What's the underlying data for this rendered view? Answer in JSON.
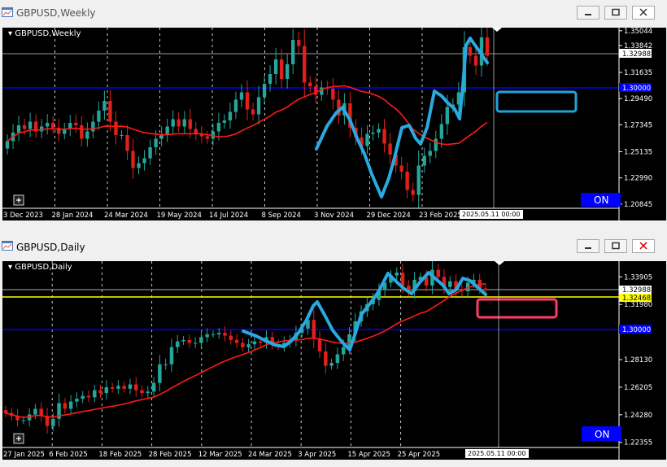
{
  "weekly": {
    "window_title": "GBPUSD,Weekly",
    "chart_label": "GBPUSD,Weekly",
    "on_label": "ON",
    "x_labels": [
      "3 Dec 2023",
      "28 Jan 2024",
      "24 Mar 2024",
      "19 May 2024",
      "14 Jul 2024",
      "8 Sep 2024",
      "3 Nov 2024",
      "29 Dec 2024",
      "23 Feb 2025"
    ],
    "date_box": "2025.05.11 00:00",
    "price_labels": [
      "1.35044",
      "1.33842",
      "1.31635",
      "1.29490",
      "1.27345",
      "1.25135",
      "1.22990",
      "1.20845"
    ],
    "current_price": "1.32988",
    "blue_line_price": "1.30000"
  },
  "daily": {
    "window_title": "GBPUSD,Daily",
    "chart_label": "GBPUSD,Daily",
    "on_label": "ON",
    "x_labels": [
      "27 Jan 2025",
      "6 Feb 2025",
      "18 Feb 2025",
      "28 Feb 2025",
      "12 Mar 2025",
      "24 Mar 2025",
      "3 Apr 2025",
      "15 Apr 2025",
      "25 Apr 2025"
    ],
    "date_box": "2025.05.11 00:00",
    "price_labels": [
      "1.33905",
      "1.31980",
      "1.28130",
      "1.26205",
      "1.24280",
      "1.22355"
    ],
    "current_price": "1.32988",
    "yellow_price": "1.32468",
    "blue_line_price": "1.30000"
  },
  "colors": {
    "bull": "#26a69a",
    "bear": "#e0201b",
    "ma": "#ff1a1a",
    "drawing": "#2aa9e0",
    "weekly_box": "#1fa5dd",
    "daily_box": "#ff3b6b",
    "level_blue": "#0000ff",
    "level_yellow": "#ffff00"
  },
  "chart_data": [
    {
      "type": "candlestick",
      "title": "GBPUSD,Weekly",
      "xlabels": [
        "3 Dec 2023",
        "28 Jan 2024",
        "24 Mar 2024",
        "19 May 2024",
        "14 Jul 2024",
        "8 Sep 2024",
        "3 Nov 2024",
        "29 Dec 2024",
        "23 Feb 2025"
      ],
      "ylim": [
        1.205,
        1.353
      ],
      "ma_period": 20,
      "close": [
        1.26,
        1.267,
        1.273,
        1.27,
        1.276,
        1.268,
        1.272,
        1.275,
        1.271,
        1.266,
        1.27,
        1.275,
        1.273,
        1.262,
        1.268,
        1.276,
        1.285,
        1.293,
        1.276,
        1.265,
        1.265,
        1.252,
        1.238,
        1.242,
        1.246,
        1.255,
        1.262,
        1.265,
        1.272,
        1.278,
        1.272,
        1.278,
        1.27,
        1.266,
        1.264,
        1.262,
        1.268,
        1.275,
        1.277,
        1.284,
        1.294,
        1.3,
        1.286,
        1.282,
        1.296,
        1.307,
        1.315,
        1.327,
        1.311,
        1.323,
        1.343,
        1.338,
        1.308,
        1.305,
        1.298,
        1.304,
        1.303,
        1.294,
        1.281,
        1.291,
        1.271,
        1.263,
        1.256,
        1.266,
        1.267,
        1.27,
        1.258,
        1.249,
        1.24,
        1.235,
        1.22,
        1.216,
        1.24,
        1.248,
        1.252,
        1.262,
        1.274,
        1.288,
        1.29,
        1.3,
        1.337,
        1.33,
        1.322,
        1.345,
        1.33
      ],
      "note": "Daily horizontal levels 1.30000, current 1.32988"
    },
    {
      "type": "candlestick",
      "title": "GBPUSD,Daily",
      "xlabels": [
        "27 Jan 2025",
        "6 Feb 2025",
        "18 Feb 2025",
        "28 Feb 2025",
        "12 Mar 2025",
        "24 Mar 2025",
        "3 Apr 2025",
        "15 Apr 2025",
        "25 Apr 2025"
      ],
      "ylim": [
        1.22,
        1.35
      ],
      "ma_period": 20,
      "close": [
        1.244,
        1.242,
        1.239,
        1.239,
        1.243,
        1.247,
        1.242,
        1.235,
        1.24,
        1.251,
        1.247,
        1.252,
        1.254,
        1.256,
        1.255,
        1.26,
        1.258,
        1.262,
        1.261,
        1.263,
        1.261,
        1.264,
        1.26,
        1.258,
        1.259,
        1.265,
        1.278,
        1.278,
        1.29,
        1.294,
        1.295,
        1.293,
        1.293,
        1.297,
        1.299,
        1.299,
        1.3,
        1.298,
        1.295,
        1.293,
        1.29,
        1.292,
        1.294,
        1.293,
        1.297,
        1.292,
        1.291,
        1.293,
        1.295,
        1.3,
        1.303,
        1.309,
        1.296,
        1.287,
        1.277,
        1.279,
        1.285,
        1.29,
        1.299,
        1.308,
        1.315,
        1.32,
        1.323,
        1.33,
        1.335,
        1.34,
        1.342,
        1.333,
        1.329,
        1.337,
        1.339,
        1.333,
        1.344,
        1.339,
        1.332,
        1.336,
        1.33,
        1.329,
        1.335,
        1.337,
        1.331,
        1.33
      ]
    }
  ]
}
